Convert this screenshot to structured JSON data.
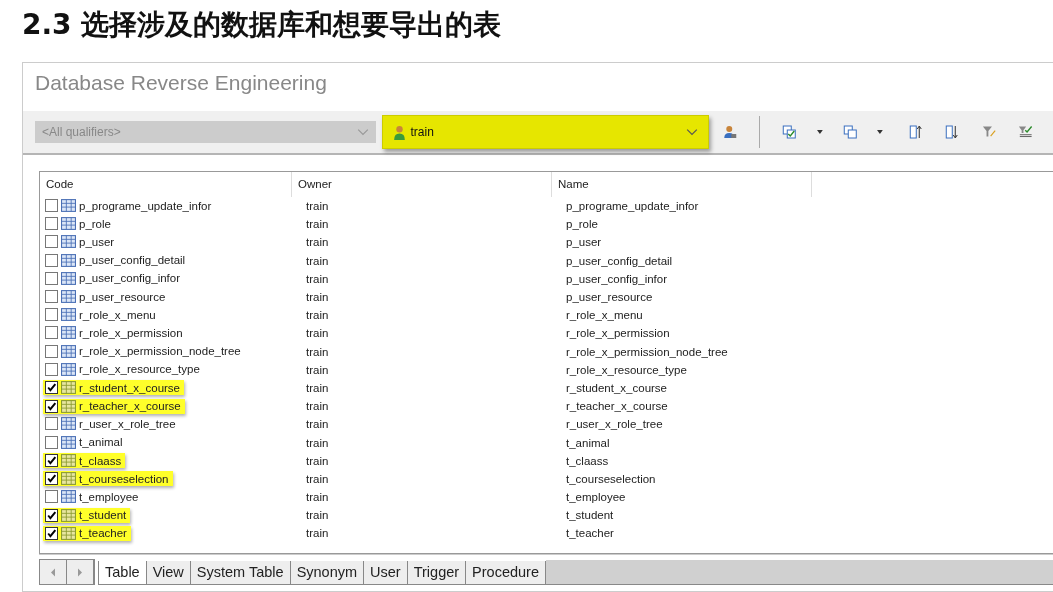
{
  "heading": "2.3 选择涉及的数据库和想要导出的表",
  "window": {
    "title": "Database Reverse Engineering"
  },
  "toolbar": {
    "qualifier": {
      "placeholder": "<All qualifiers>",
      "disabled": true
    },
    "owner": {
      "value": "train",
      "highlighted": true
    }
  },
  "table": {
    "columns": [
      "Code",
      "Owner",
      "Name"
    ],
    "rows": [
      {
        "code": "p_programe_update_infor",
        "owner": "train",
        "name": "p_programe_update_infor",
        "checked": false
      },
      {
        "code": "p_role",
        "owner": "train",
        "name": "p_role",
        "checked": false
      },
      {
        "code": "p_user",
        "owner": "train",
        "name": "p_user",
        "checked": false
      },
      {
        "code": "p_user_config_detail",
        "owner": "train",
        "name": "p_user_config_detail",
        "checked": false
      },
      {
        "code": "p_user_config_infor",
        "owner": "train",
        "name": "p_user_config_infor",
        "checked": false
      },
      {
        "code": "p_user_resource",
        "owner": "train",
        "name": "p_user_resource",
        "checked": false
      },
      {
        "code": "r_role_x_menu",
        "owner": "train",
        "name": "r_role_x_menu",
        "checked": false
      },
      {
        "code": "r_role_x_permission",
        "owner": "train",
        "name": "r_role_x_permission",
        "checked": false
      },
      {
        "code": "r_role_x_permission_node_tree",
        "owner": "train",
        "name": "r_role_x_permission_node_tree",
        "checked": false
      },
      {
        "code": "r_role_x_resource_type",
        "owner": "train",
        "name": "r_role_x_resource_type",
        "checked": false
      },
      {
        "code": "r_student_x_course",
        "owner": "train",
        "name": "r_student_x_course",
        "checked": true
      },
      {
        "code": "r_teacher_x_course",
        "owner": "train",
        "name": "r_teacher_x_course",
        "checked": true
      },
      {
        "code": "r_user_x_role_tree",
        "owner": "train",
        "name": "r_user_x_role_tree",
        "checked": false
      },
      {
        "code": "t_animal",
        "owner": "train",
        "name": "t_animal",
        "checked": false
      },
      {
        "code": "t_claass",
        "owner": "train",
        "name": "t_claass",
        "checked": true
      },
      {
        "code": "t_courseselection",
        "owner": "train",
        "name": "t_courseselection",
        "checked": true
      },
      {
        "code": "t_employee",
        "owner": "train",
        "name": "t_employee",
        "checked": false
      },
      {
        "code": "t_student",
        "owner": "train",
        "name": "t_student",
        "checked": true
      },
      {
        "code": "t_teacher",
        "owner": "train",
        "name": "t_teacher",
        "checked": true
      }
    ]
  },
  "tabs": [
    {
      "label": "Table",
      "selected": true
    },
    {
      "label": "View",
      "selected": false
    },
    {
      "label": "System Table",
      "selected": false
    },
    {
      "label": "Synonym",
      "selected": false
    },
    {
      "label": "User",
      "selected": false
    },
    {
      "label": "Trigger",
      "selected": false
    },
    {
      "label": "Procedure",
      "selected": false
    }
  ]
}
